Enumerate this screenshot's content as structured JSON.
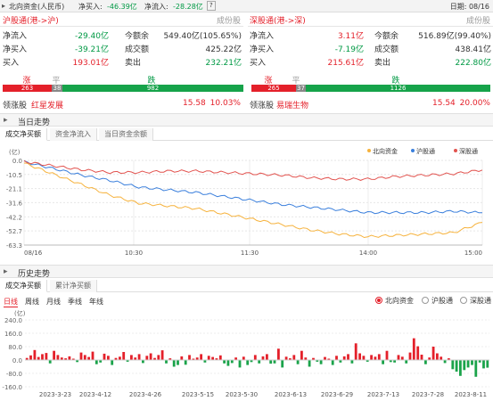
{
  "titlebar": {
    "title": "北向资金(人民币)",
    "net_buy_label": "净买入:",
    "net_buy_value": "-46.39亿",
    "net_inflow_label": "净流入:",
    "net_inflow_value": "-28.28亿",
    "help": "?",
    "date_label": "日期: 08/16"
  },
  "markets": [
    {
      "name": "沪股通(港->沪)",
      "constituents": "成份股",
      "rows": [
        {
          "l1": "净流入",
          "v1": "-29.40亿",
          "l2": "今额余",
          "v2": "549.40亿(105.65%)"
        },
        {
          "l1": "净买入",
          "v1": "-39.21亿",
          "l2": "成交额",
          "v2": "425.22亿"
        },
        {
          "l1": "买入",
          "v1": "193.01亿",
          "l2": "卖出",
          "v2": "232.21亿"
        }
      ],
      "breadth": {
        "up_label": "涨",
        "flat_label": "平",
        "down_label": "跌",
        "up": "263",
        "flat": "38",
        "down": "982"
      },
      "leading": {
        "label": "领涨股",
        "name": "红星发展",
        "price": "15.58",
        "pct": "10.03%"
      }
    },
    {
      "name": "深股通(港->深)",
      "constituents": "成份股",
      "rows": [
        {
          "l1": "净流入",
          "v1": "3.11亿",
          "l2": "今额余",
          "v2": "516.89亿(99.40%)"
        },
        {
          "l1": "净买入",
          "v1": "-7.19亿",
          "l2": "成交额",
          "v2": "438.41亿"
        },
        {
          "l1": "买入",
          "v1": "215.61亿",
          "l2": "卖出",
          "v2": "222.80亿"
        }
      ],
      "breadth": {
        "up_label": "涨",
        "flat_label": "平",
        "down_label": "跌",
        "up": "265",
        "flat": "37",
        "down": "1126"
      },
      "leading": {
        "label": "领涨股",
        "name": "易瑞生物",
        "price": "15.54",
        "pct": "20.00%"
      }
    }
  ],
  "intraday": {
    "section_title": "当日走势",
    "tabs": [
      "成交净买额",
      "资金净流入",
      "当日资金余额"
    ],
    "unit": "(亿)",
    "legend": [
      "北向资金",
      "沪股通",
      "深股通"
    ]
  },
  "history": {
    "section_title": "历史走势",
    "tabs": [
      "成交净买额",
      "累计净买额"
    ],
    "periods": [
      "日线",
      "周线",
      "月线",
      "季线",
      "年线"
    ],
    "radios": [
      "北向资金",
      "沪股通",
      "深股通"
    ],
    "unit": "(亿)"
  },
  "colors": {
    "up": "#e4202a",
    "down": "#009944",
    "north": "#f6b23c",
    "sh": "#3a7fdc",
    "sz": "#e2534f"
  },
  "chart_data": [
    {
      "type": "line",
      "x_ticks": [
        "08/16",
        "10:30",
        "11:30",
        "14:00",
        "15:00"
      ],
      "y_ticks": [
        0.0,
        -10.5,
        -21.1,
        -31.6,
        -42.2,
        -52.7,
        -63.3
      ],
      "ylim": [
        -63.3,
        0.0
      ],
      "legend_position": "top-right",
      "x": [
        "09:30",
        "09:45",
        "10:00",
        "10:15",
        "10:30",
        "10:45",
        "11:00",
        "11:15",
        "11:30",
        "13:15",
        "13:30",
        "13:45",
        "14:00",
        "14:15",
        "14:30",
        "14:45",
        "15:00"
      ],
      "series": [
        {
          "name": "北向资金",
          "values": [
            -2,
            -10,
            -18,
            -26,
            -32,
            -34,
            -36,
            -40,
            -44,
            -48,
            -52,
            -55,
            -57,
            -56,
            -55,
            -54,
            -46.39
          ]
        },
        {
          "name": "沪股通",
          "values": [
            -1,
            -6,
            -11,
            -15,
            -20,
            -22,
            -24,
            -27,
            -30,
            -33,
            -35,
            -37,
            -39,
            -39,
            -39,
            -38,
            -39.21
          ]
        },
        {
          "name": "深股通",
          "values": [
            -1,
            -4,
            -7,
            -9,
            -9,
            -8,
            -8,
            -9,
            -10,
            -11,
            -13,
            -14,
            -14,
            -12,
            -11,
            -10,
            -7.19
          ]
        }
      ]
    },
    {
      "type": "bar",
      "y_ticks": [
        240.0,
        160.0,
        80.0,
        0.0,
        -80.0,
        -160.0
      ],
      "ylim": [
        -160,
        240
      ],
      "x_tick_labels": [
        "2023-3-23",
        "2023-4-12",
        "2023-4-26",
        "2023-5-15",
        "2023-5-30",
        "2023-6-13",
        "2023-6-29",
        "2023-7-13",
        "2023-7-28",
        "2023-8-11"
      ],
      "values": [
        12,
        28,
        60,
        18,
        35,
        42,
        -20,
        55,
        30,
        15,
        10,
        22,
        8,
        -12,
        45,
        30,
        18,
        50,
        -25,
        -15,
        38,
        25,
        -30,
        12,
        20,
        48,
        -10,
        30,
        15,
        35,
        -18,
        25,
        40,
        12,
        30,
        58,
        -20,
        10,
        -40,
        -30,
        22,
        -28,
        30,
        8,
        15,
        35,
        -15,
        25,
        18,
        10,
        28,
        -20,
        -35,
        -18,
        15,
        -45,
        20,
        -30,
        -12,
        30,
        -20,
        22,
        35,
        -22,
        -20,
        68,
        -45,
        20,
        10,
        30,
        -25,
        55,
        15,
        -40,
        12,
        -10,
        -25,
        18,
        8,
        -30,
        25,
        -15,
        22,
        35,
        -20,
        100,
        40,
        25,
        -10,
        30,
        20,
        35,
        -25,
        55,
        -12,
        -15,
        30,
        20,
        -20,
        45,
        130,
        82,
        32,
        -25,
        15,
        80,
        40,
        20,
        -18,
        10,
        -55,
        -70,
        -95,
        -60,
        -45,
        -30,
        -100,
        -15,
        -50,
        -46
      ]
    }
  ]
}
